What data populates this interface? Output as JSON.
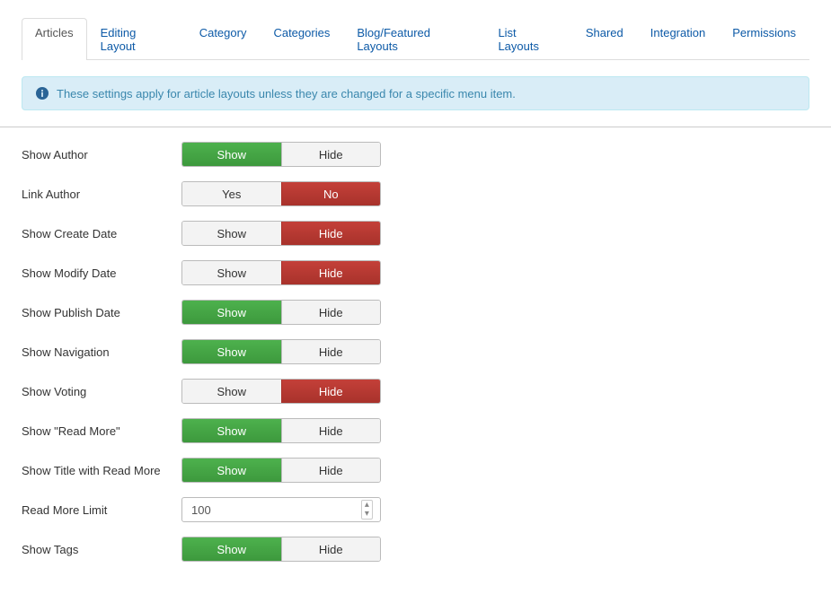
{
  "tabs": {
    "items": [
      {
        "label": "Articles",
        "active": true
      },
      {
        "label": "Editing Layout",
        "active": false
      },
      {
        "label": "Category",
        "active": false
      },
      {
        "label": "Categories",
        "active": false
      },
      {
        "label": "Blog/Featured Layouts",
        "active": false
      },
      {
        "label": "List Layouts",
        "active": false
      },
      {
        "label": "Shared",
        "active": false
      },
      {
        "label": "Integration",
        "active": false
      },
      {
        "label": "Permissions",
        "active": false
      }
    ]
  },
  "alert": {
    "text": "These settings apply for article layouts unless they are changed for a specific menu item."
  },
  "options": {
    "show_hide": {
      "show": "Show",
      "hide": "Hide"
    },
    "yes_no": {
      "yes": "Yes",
      "no": "No"
    }
  },
  "fields": [
    {
      "label": "Show Author",
      "type": "show_hide",
      "selected": 0
    },
    {
      "label": "Link Author",
      "type": "yes_no",
      "selected": 1
    },
    {
      "label": "Show Create Date",
      "type": "show_hide",
      "selected": 1
    },
    {
      "label": "Show Modify Date",
      "type": "show_hide",
      "selected": 1
    },
    {
      "label": "Show Publish Date",
      "type": "show_hide",
      "selected": 0
    },
    {
      "label": "Show Navigation",
      "type": "show_hide",
      "selected": 0
    },
    {
      "label": "Show Voting",
      "type": "show_hide",
      "selected": 1
    },
    {
      "label": "Show \"Read More\"",
      "type": "show_hide",
      "selected": 0
    },
    {
      "label": "Show Title with Read More",
      "type": "show_hide",
      "selected": 0
    },
    {
      "label": "Read More Limit",
      "type": "number",
      "value": "100"
    },
    {
      "label": "Show Tags",
      "type": "show_hide",
      "selected": 0
    }
  ]
}
